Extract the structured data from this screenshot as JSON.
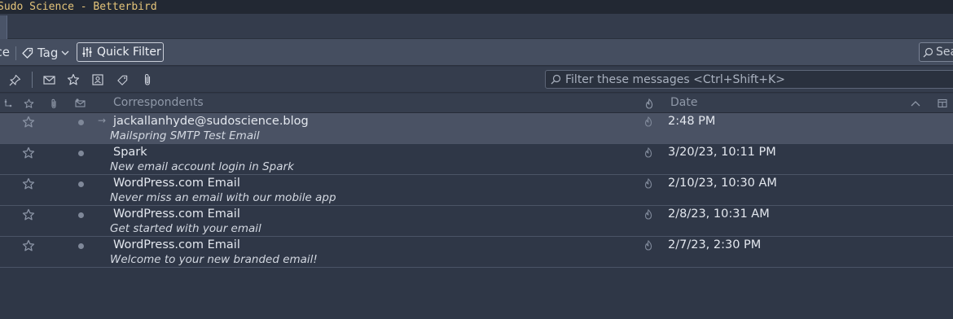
{
  "window": {
    "title": "Sudo Science - Betterbird"
  },
  "toolbar": {
    "cut_label": "ce",
    "tag_label": "Tag",
    "quick_filter_label": "Quick Filter",
    "search_label": "Search"
  },
  "filter": {
    "placeholder": "Filter these messages <Ctrl+Shift+K>"
  },
  "columns": {
    "correspondents": "Correspondents",
    "date": "Date"
  },
  "messages": [
    {
      "from": "jackallanhyde@sudoscience.blog",
      "subject": "Mailspring SMTP Test Email",
      "date": "2:48 PM",
      "selected": true
    },
    {
      "from": "Spark",
      "subject": "New email account login in Spark",
      "date": "3/20/23, 10:11 PM"
    },
    {
      "from": "WordPress.com Email",
      "subject": "Never miss an email with our mobile app",
      "date": "2/10/23, 10:30 AM"
    },
    {
      "from": "WordPress.com Email",
      "subject": "Get started with your email",
      "date": "2/8/23, 10:31 AM"
    },
    {
      "from": "WordPress.com Email",
      "subject": "Welcome to your new branded email!",
      "date": "2/7/23, 2:30 PM"
    }
  ],
  "colors": {
    "background": "#2f3747",
    "title_text": "#e4c47a",
    "selected_row": "#4a5264"
  }
}
